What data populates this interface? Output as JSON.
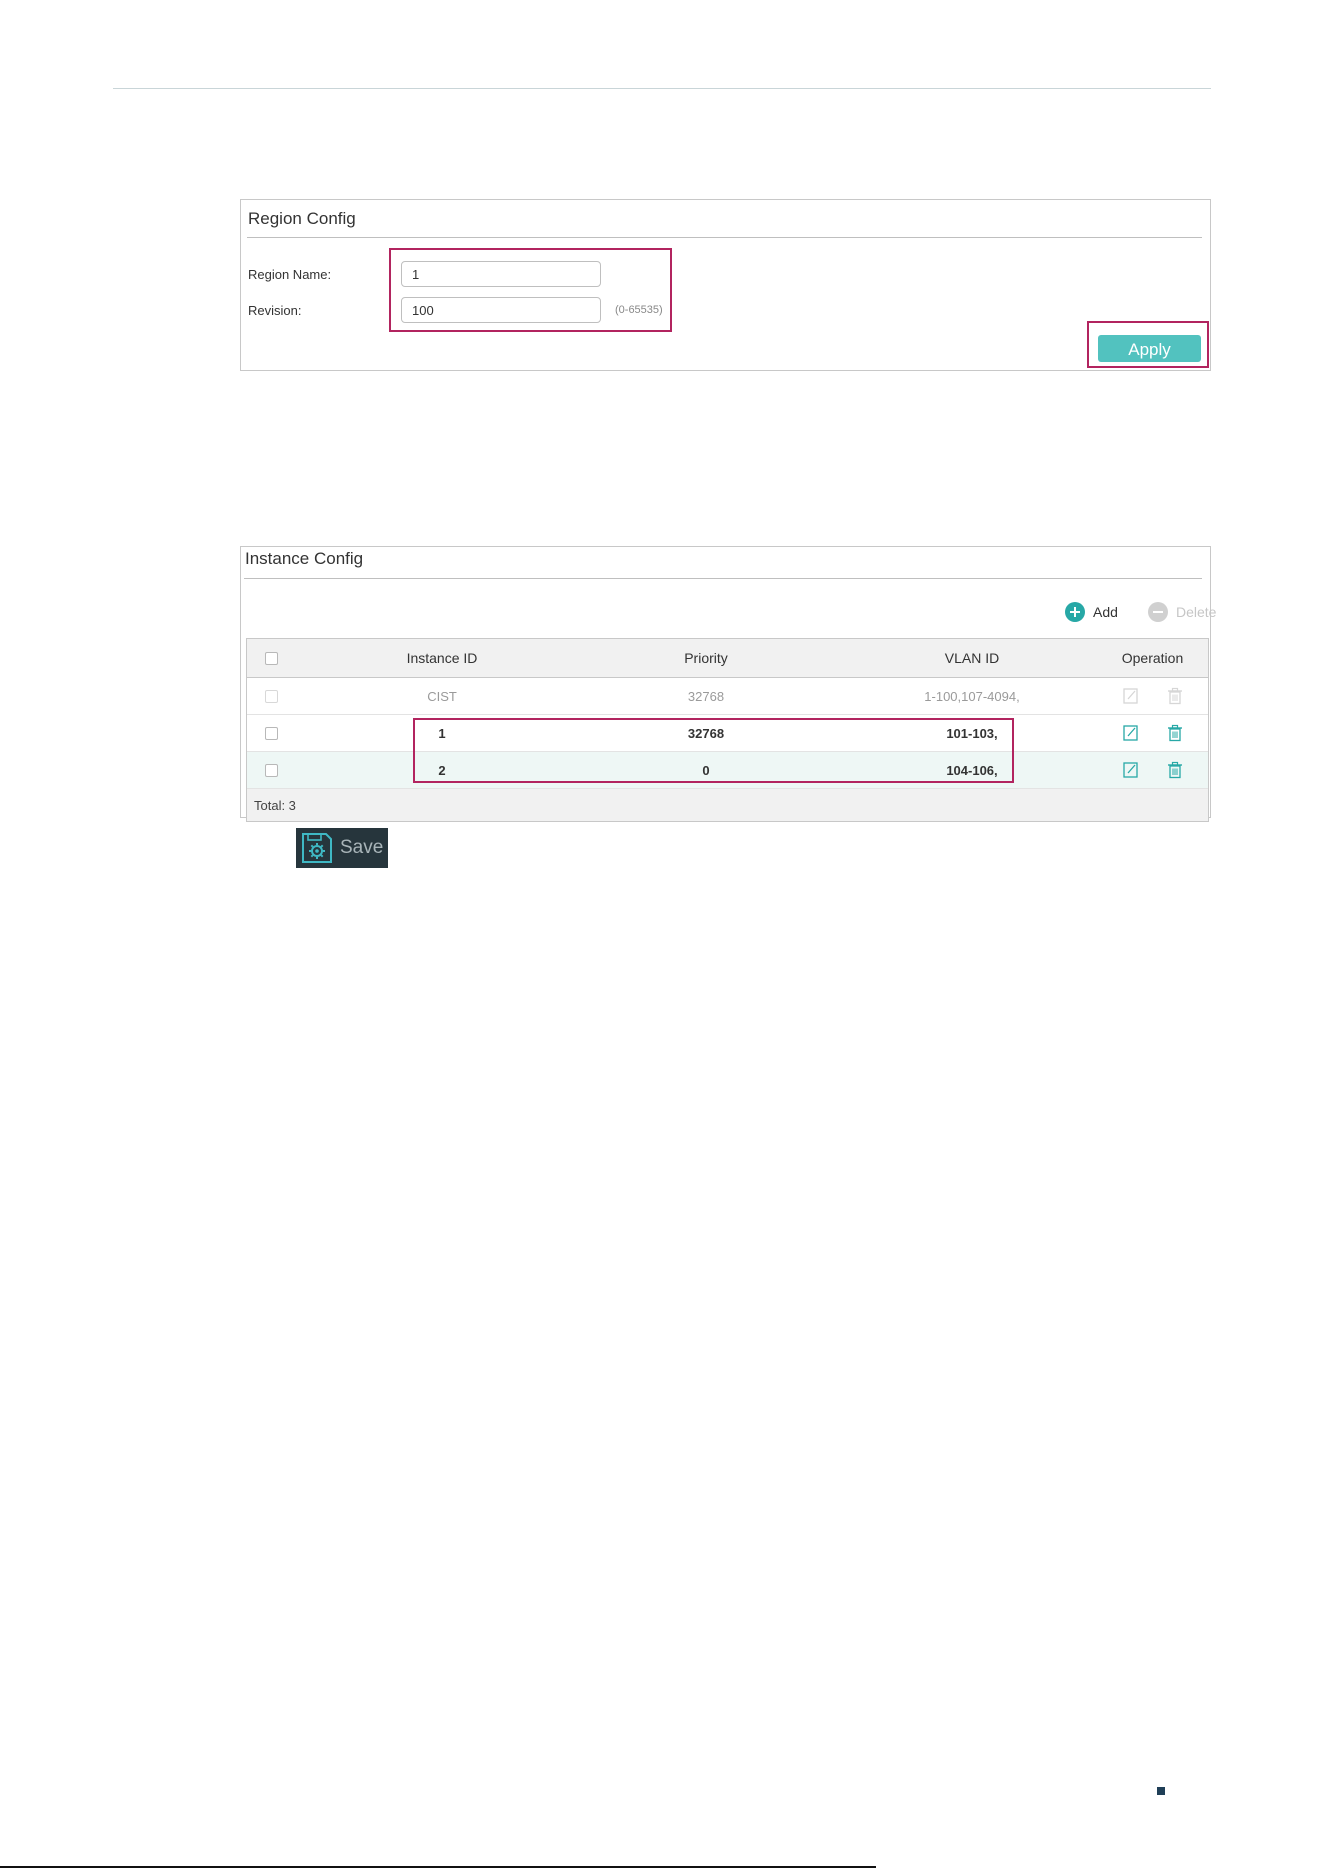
{
  "region_config": {
    "title": "Region Config",
    "region_name_label": "Region Name:",
    "region_name_value": "1",
    "revision_label": "Revision:",
    "revision_value": "100",
    "revision_hint": "(0-65535)",
    "apply_label": "Apply"
  },
  "instance_config": {
    "title": "Instance Config",
    "add_label": "Add",
    "delete_label": "Delete",
    "columns": [
      "Instance ID",
      "Priority",
      "VLAN ID",
      "Operation"
    ],
    "rows": [
      {
        "instance_id": "CIST",
        "priority": "32768",
        "vlan_id": "1-100,107-4094,"
      },
      {
        "instance_id": "1",
        "priority": "32768",
        "vlan_id": "101-103,"
      },
      {
        "instance_id": "2",
        "priority": "0",
        "vlan_id": "104-106,"
      }
    ],
    "total_label": "Total: 3"
  },
  "save": {
    "label": "Save"
  },
  "colors": {
    "accent": "#52c2bf",
    "icon_teal": "#27a8a6",
    "highlight": "#b2245f",
    "save_bg": "#26353c"
  },
  "icons": [
    "add-circle-icon",
    "delete-circle-icon",
    "edit-icon",
    "trash-icon",
    "save-gear-icon"
  ]
}
